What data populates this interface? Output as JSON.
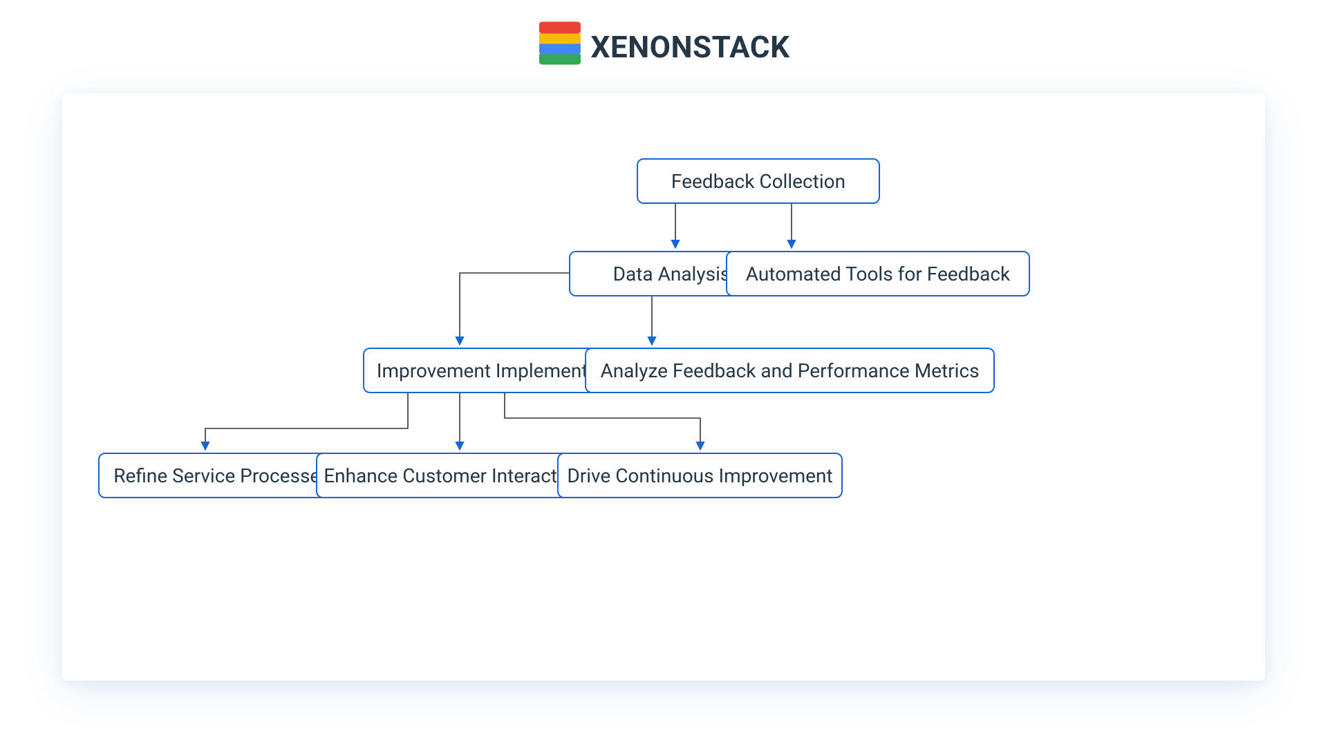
{
  "brand": {
    "name": "XENONSTACK"
  },
  "diagram": {
    "nodes": {
      "feedback_collection": "Feedback Collection",
      "data_analysis": "Data Analysis",
      "automated_tools": "Automated Tools for Feedback",
      "improvement_implementation": "Improvement Implementation",
      "analyze_feedback_metrics": "Analyze Feedback and Performance Metrics",
      "refine_service_processes": "Refine Service Processes",
      "enhance_customer_interactions": "Enhance Customer Interactions",
      "drive_continuous_improvement": "Drive Continuous Improvement"
    }
  }
}
